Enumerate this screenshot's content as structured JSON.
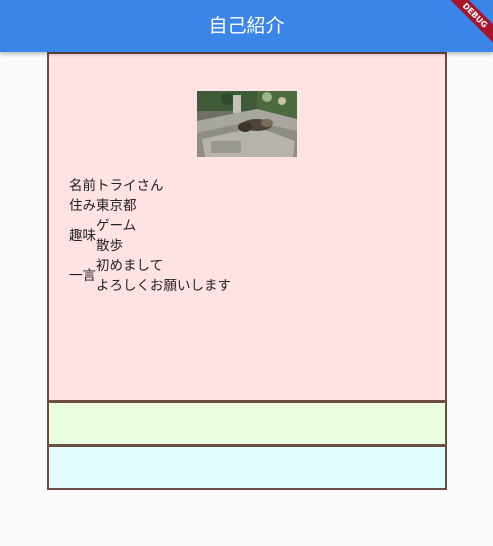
{
  "app_bar": {
    "title": "自己紹介",
    "debug_label": "DEBUG"
  },
  "profile": {
    "name": {
      "label": "名前",
      "value": "トライさん"
    },
    "residence": {
      "label": "住み",
      "value": "東京都"
    },
    "hobbies": {
      "label": "趣味",
      "values": [
        "ゲーム",
        "散歩"
      ]
    },
    "comment": {
      "label": "一言",
      "values": [
        "初めまして",
        "よろしくお願いします"
      ]
    }
  }
}
